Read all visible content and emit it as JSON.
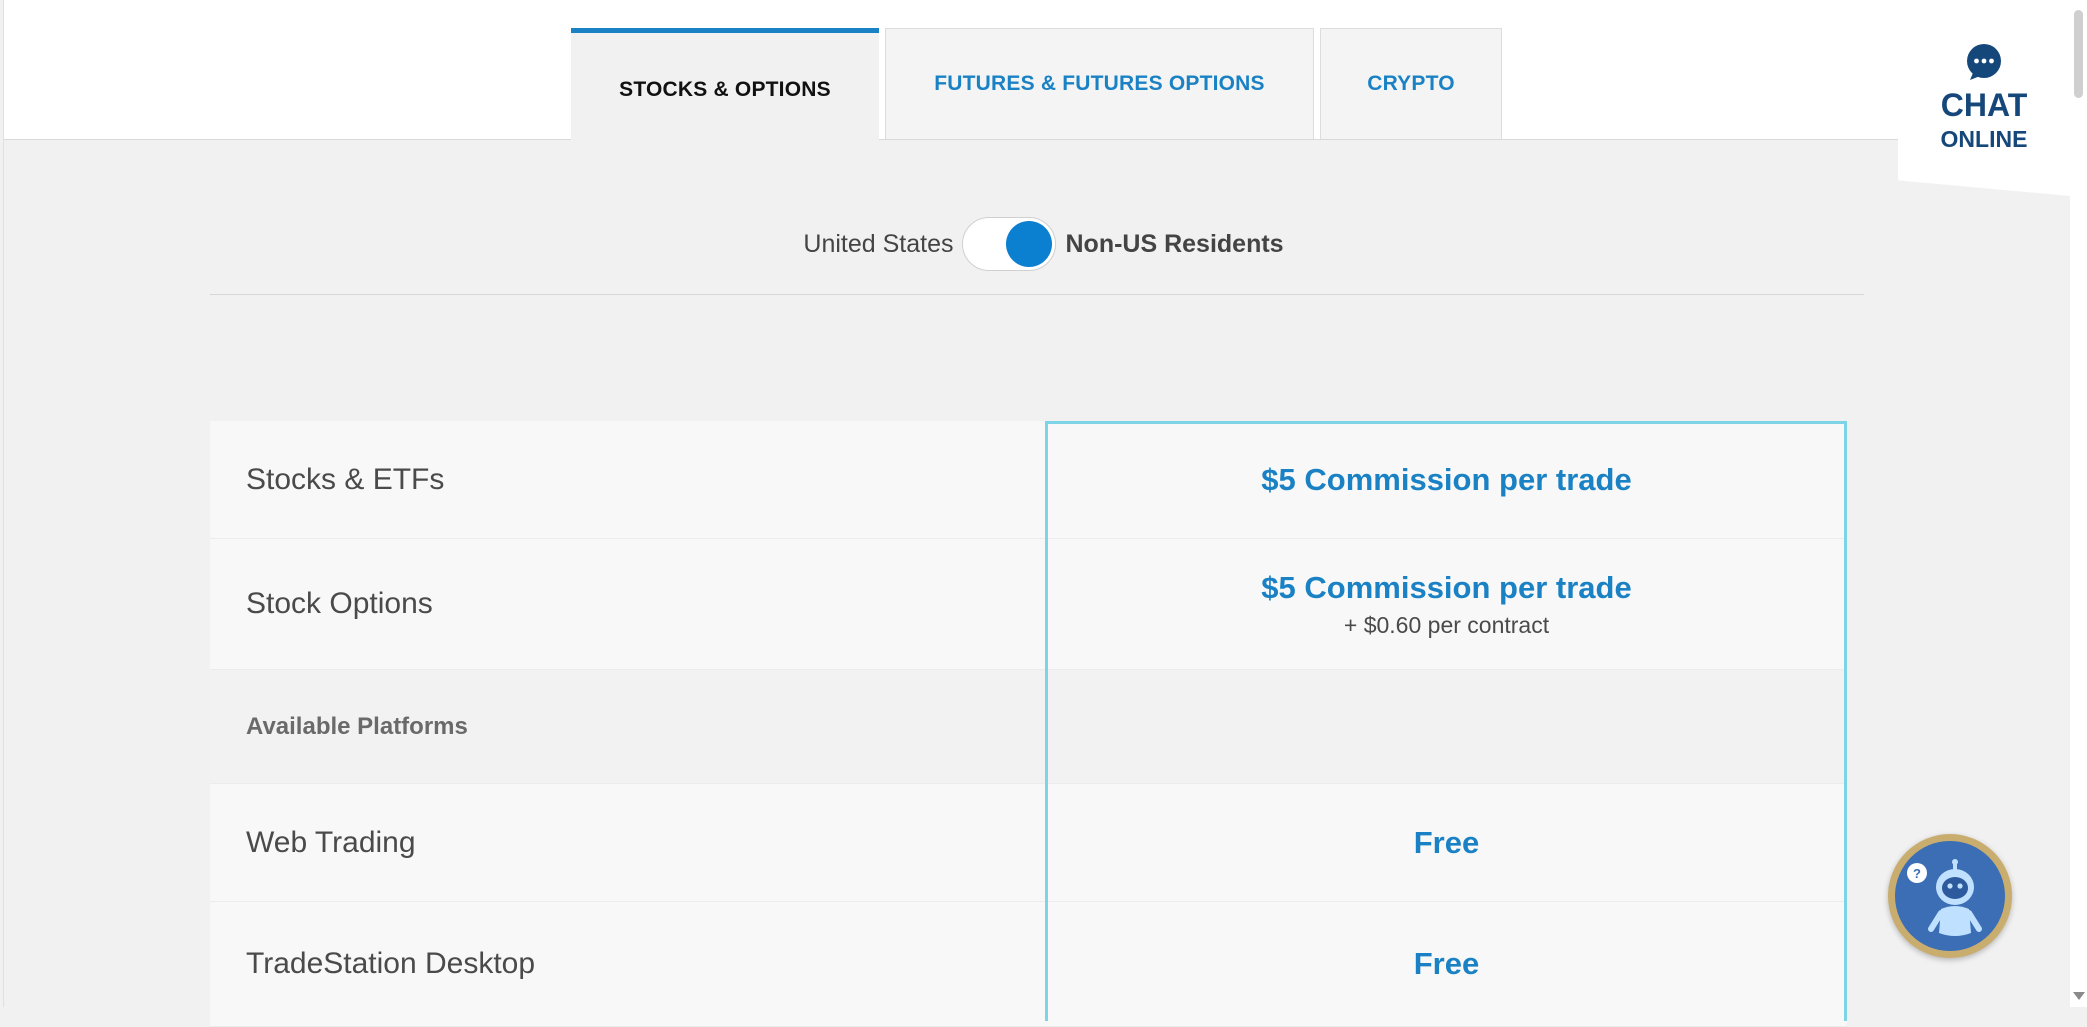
{
  "tabs": [
    {
      "label": "STOCKS & OPTIONS",
      "active": true
    },
    {
      "label": "FUTURES & FUTURES OPTIONS",
      "active": false
    },
    {
      "label": "CRYPTO",
      "active": false
    }
  ],
  "residency_toggle": {
    "left_label": "United States",
    "right_label": "Non-US Residents",
    "selected": "Non-US Residents"
  },
  "pricing": {
    "stocks_etfs": {
      "label": "Stocks & ETFs",
      "price": "$5 Commission per trade"
    },
    "stock_options": {
      "label": "Stock Options",
      "price": "$5 Commission per trade",
      "extra": "+ $0.60 per contract"
    },
    "platforms_heading": "Available Platforms",
    "web_trading": {
      "label": "Web Trading",
      "price": "Free"
    },
    "desktop": {
      "label": "TradeStation Desktop",
      "price": "Free"
    }
  },
  "chat": {
    "line1": "CHAT",
    "line2": "ONLINE"
  },
  "colors": {
    "accent": "#1a82c4",
    "highlight_border": "#7dd4e6",
    "chat_text": "#16477a"
  },
  "icons": {
    "chat": "chat-bubble-icon",
    "assistant": "robot-assistant-icon"
  }
}
